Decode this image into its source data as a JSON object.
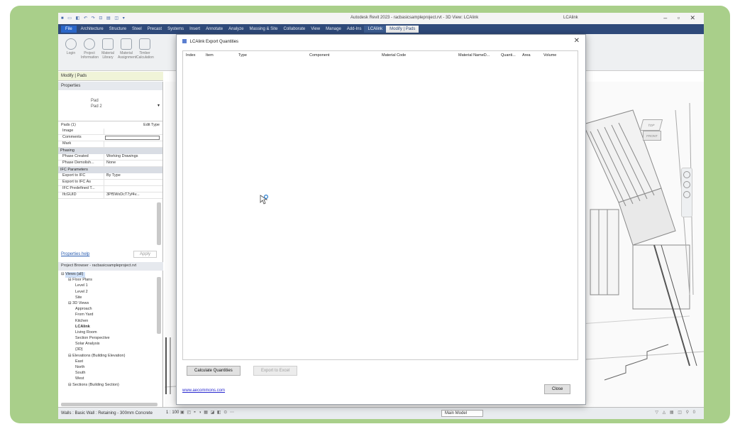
{
  "titlebar": {
    "app_title": "Autodesk Revit 2023 - racbasicsampleproject.rvt - 3D View: LCAlink",
    "user": "LCAlink"
  },
  "ribbon_tabs": [
    "File",
    "Architecture",
    "Structure",
    "Steel",
    "Precast",
    "Systems",
    "Insert",
    "Annotate",
    "Analyze",
    "Massing & Site",
    "Collaborate",
    "View",
    "Manage",
    "Add-Ins",
    "LCAlink",
    "Modify | Pads"
  ],
  "ribbon_buttons": [
    {
      "label": "Login",
      "icon": "login-icon"
    },
    {
      "label": "Project Information",
      "icon": "info-icon"
    },
    {
      "label": "Material Library",
      "icon": "library-icon"
    },
    {
      "label": "Material Assignment",
      "icon": "list-icon"
    },
    {
      "label": "Timber Calculation",
      "icon": "grid-icon"
    }
  ],
  "context_bar": "Modify | Pads",
  "properties": {
    "header": "Properties",
    "type_family": "Pad",
    "type_name": "Pad 2",
    "filter_label": "Pads (1)",
    "edit_type": "Edit Type",
    "rows_top": [
      {
        "k": "Image",
        "v": ""
      },
      {
        "k": "Comments",
        "v": "",
        "box": true
      },
      {
        "k": "Mark",
        "v": ""
      }
    ],
    "section_phasing": "Phasing",
    "rows_phasing": [
      {
        "k": "Phase Created",
        "v": "Working Drawings"
      },
      {
        "k": "Phase Demolish...",
        "v": "None"
      }
    ],
    "section_ifc": "IFC Parameters",
    "rows_ifc": [
      {
        "k": "Export to IFC",
        "v": "By Type"
      },
      {
        "k": "Export to IFC As",
        "v": ""
      },
      {
        "k": "IFC Predefined T...",
        "v": ""
      },
      {
        "k": "IfcGUID",
        "v": "3Pf5WxDcT7yf4v..."
      }
    ],
    "help_link": "Properties help",
    "apply": "Apply"
  },
  "project_browser": {
    "header": "Project Browser - racbasicsampleproject.rvt",
    "items": [
      {
        "label": "Views (all)",
        "indent": 0,
        "sel": true
      },
      {
        "label": "Floor Plans",
        "indent": 1
      },
      {
        "label": "Level 1",
        "indent": 2
      },
      {
        "label": "Level 2",
        "indent": 2
      },
      {
        "label": "Site",
        "indent": 2
      },
      {
        "label": "3D Views",
        "indent": 1
      },
      {
        "label": "Approach",
        "indent": 2
      },
      {
        "label": "From Yard",
        "indent": 2
      },
      {
        "label": "Kitchen",
        "indent": 2
      },
      {
        "label": "LCAlink",
        "indent": 2,
        "bold": true
      },
      {
        "label": "Living Room",
        "indent": 2
      },
      {
        "label": "Section Perspective",
        "indent": 2
      },
      {
        "label": "Solar Analysis",
        "indent": 2
      },
      {
        "label": "{3D}",
        "indent": 2
      },
      {
        "label": "Elevations (Building Elevation)",
        "indent": 1
      },
      {
        "label": "East",
        "indent": 2
      },
      {
        "label": "North",
        "indent": 2
      },
      {
        "label": "South",
        "indent": 2
      },
      {
        "label": "West",
        "indent": 2
      },
      {
        "label": "Sections (Building Section)",
        "indent": 1
      }
    ]
  },
  "viewcube": {
    "top": "TOP",
    "front": "FRONT"
  },
  "statusbar": {
    "text": "Walls : Basic Wall : Retaining - 300mm Concrete",
    "scale": "1 : 100",
    "model": "Main Model"
  },
  "dialog": {
    "title": "LCAlink Export Quantities",
    "columns": [
      "Index",
      "Item",
      "Type",
      "Component",
      "Material Code",
      "Material NameD...",
      "Quanti...",
      "Area",
      "Volume"
    ],
    "calc_button": "Calculate Quantities",
    "export_button": "Export to Excel",
    "link": "www.aecommons.com",
    "close_button": "Close"
  }
}
